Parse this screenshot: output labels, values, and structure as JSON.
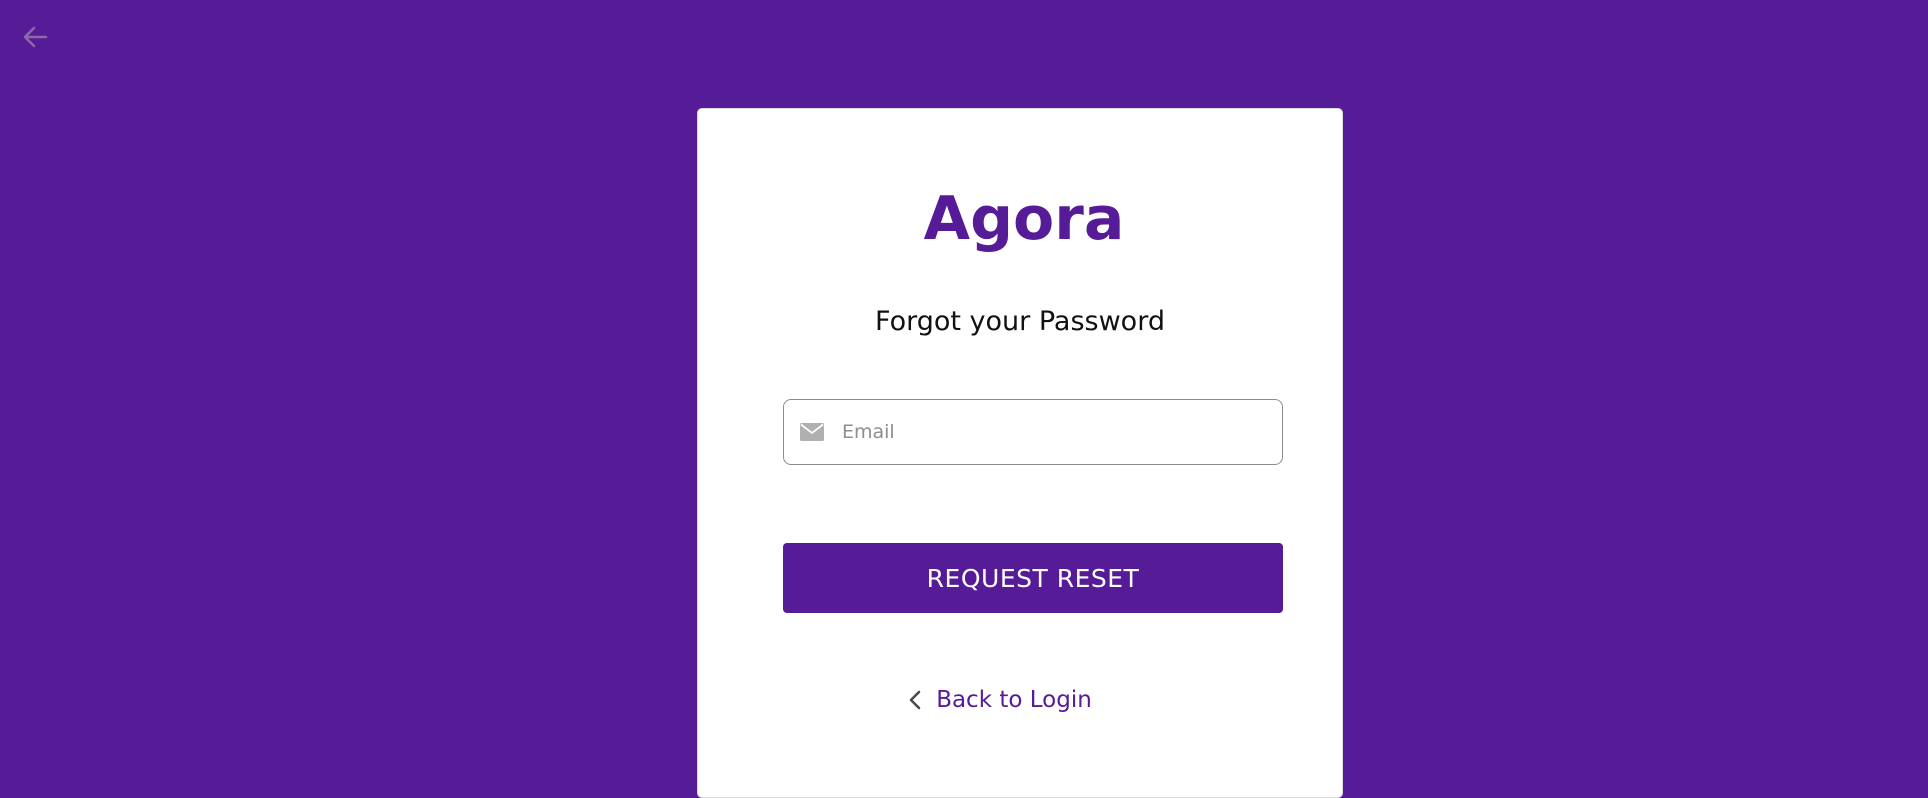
{
  "page": {
    "background_color": "#561b96",
    "back_icon": "arrow-left-icon"
  },
  "card": {
    "brand": "Agora",
    "subtitle": "Forgot your Password",
    "email": {
      "icon": "mail-icon",
      "placeholder": "Email",
      "value": ""
    },
    "request_button_label": "REQUEST RESET",
    "back_link": {
      "icon": "chevron-left-icon",
      "label": "Back to Login"
    },
    "accent_color": "#561b96"
  }
}
